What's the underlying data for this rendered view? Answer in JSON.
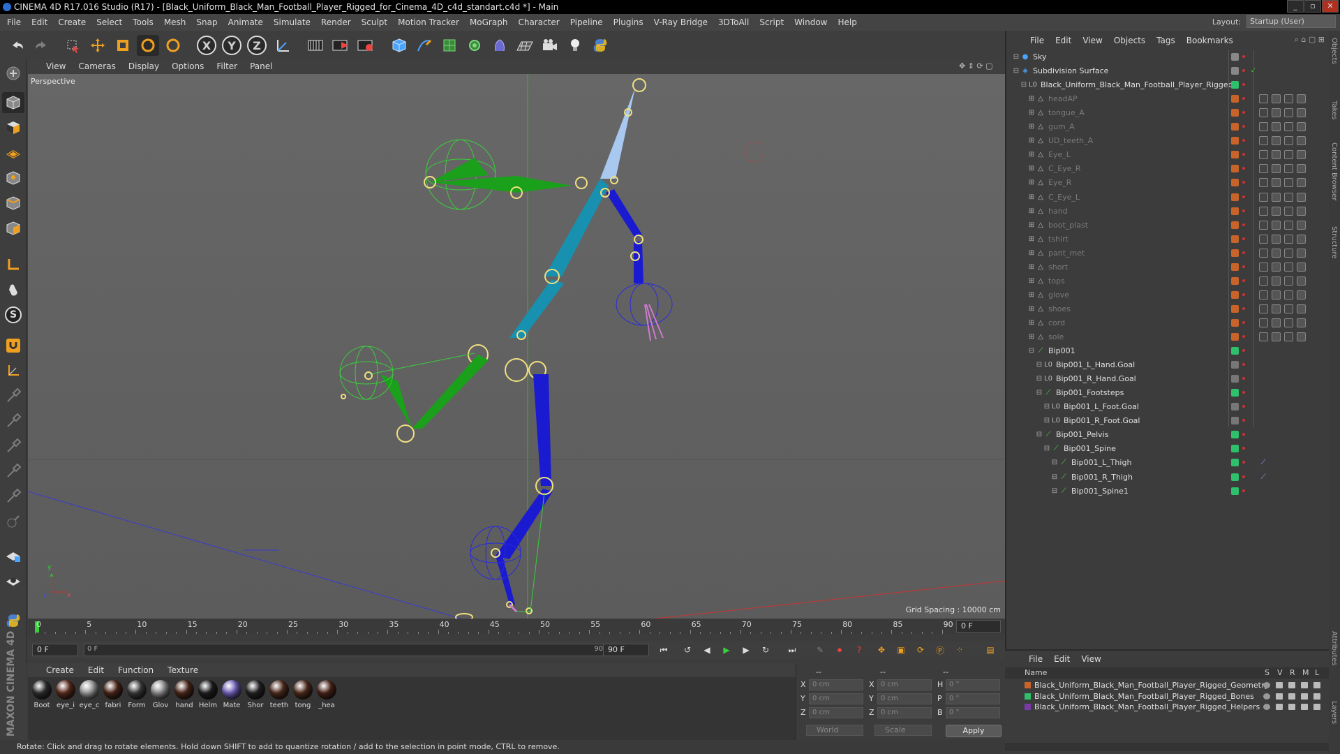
{
  "window": {
    "title": "CINEMA 4D R17.016 Studio (R17) - [Black_Uniform_Black_Man_Football_Player_Rigged_for_Cinema_4D_c4d_standart.c4d *] - Main",
    "controls": [
      "_",
      "▫",
      "✕"
    ]
  },
  "menubar": {
    "items": [
      "File",
      "Edit",
      "Create",
      "Select",
      "Tools",
      "Mesh",
      "Snap",
      "Animate",
      "Simulate",
      "Render",
      "Sculpt",
      "Motion Tracker",
      "MoGraph",
      "Character",
      "Pipeline",
      "Plugins",
      "V-Ray Bridge",
      "3DToAll",
      "Script",
      "Window",
      "Help"
    ],
    "layout_label": "Layout:",
    "layout_value": "Startup (User)"
  },
  "toolbar": {
    "axis_x": "X",
    "axis_y": "Y",
    "axis_z": "Z"
  },
  "lefttoolbar": {
    "snap_label": "S"
  },
  "viewport": {
    "menu": [
      "View",
      "Cameras",
      "Display",
      "Options",
      "Filter",
      "Panel"
    ],
    "label": "Perspective",
    "grid_spacing": "Grid Spacing : 10000 cm",
    "axis_labels": [
      "y",
      "x",
      "z"
    ]
  },
  "timeline": {
    "ticks": [
      "0",
      "5",
      "10",
      "15",
      "20",
      "25",
      "30",
      "35",
      "40",
      "45",
      "50",
      "55",
      "60",
      "65",
      "70",
      "75",
      "80",
      "85",
      "90"
    ],
    "current_frame": "0 F"
  },
  "playbar": {
    "start_field": "0 F",
    "slider_start": "0 F",
    "slider_end": "90 F",
    "end_field": "90 F"
  },
  "material_manager": {
    "menu": [
      "Create",
      "Edit",
      "Function",
      "Texture"
    ],
    "materials": [
      {
        "name": "Boot",
        "color": "#2e2e2e"
      },
      {
        "name": "eye_i",
        "color": "#5a2a1c"
      },
      {
        "name": "eye_c",
        "color": "#9a9a9a"
      },
      {
        "name": "fabri",
        "color": "#4a2418"
      },
      {
        "name": "Form",
        "color": "#3a3a3a"
      },
      {
        "name": "Glov",
        "color": "#8c8c8c"
      },
      {
        "name": "hand",
        "color": "#4b2619"
      },
      {
        "name": "Helm",
        "color": "#1e1e1e"
      },
      {
        "name": "Mate",
        "color": "#7060b8"
      },
      {
        "name": "Shor",
        "color": "#222222"
      },
      {
        "name": "teeth",
        "color": "#4e2a1c"
      },
      {
        "name": "tong",
        "color": "#4e2a1c"
      },
      {
        "name": "_hea",
        "color": "#4a2418"
      }
    ]
  },
  "coordinates": {
    "header_left": "--",
    "header_mid": "--",
    "header_right": "--",
    "rows": [
      {
        "a": "X",
        "av": "0 cm",
        "b": "X",
        "bv": "0 cm",
        "c": "H",
        "cv": "0 °"
      },
      {
        "a": "Y",
        "av": "0 cm",
        "b": "Y",
        "bv": "0 cm",
        "c": "P",
        "cv": "0 °"
      },
      {
        "a": "Z",
        "av": "0 cm",
        "b": "Z",
        "bv": "0 cm",
        "c": "B",
        "cv": "0 °"
      }
    ],
    "world": "World",
    "scale": "Scale",
    "apply": "Apply"
  },
  "brand": "MAXON CINEMA 4D",
  "status": "Rotate: Click and drag to rotate elements. Hold down SHIFT to add to quantize rotation / add to the selection in point mode, CTRL to remove.",
  "object_manager": {
    "menu": [
      "File",
      "Edit",
      "View",
      "Objects",
      "Tags",
      "Bookmarks"
    ],
    "objects": [
      {
        "name": "Sky",
        "indent": 0,
        "icon": "●",
        "color": "#4aa3ff",
        "dim": false
      },
      {
        "name": "Subdivision Surface",
        "indent": 0,
        "icon": "◈",
        "color": "#4aa3ff",
        "dim": false
      },
      {
        "name": "Black_Uniform_Black_Man_Football_Player_Rigged",
        "indent": 1,
        "icon": "L0",
        "color": "#bbb",
        "dim": false
      },
      {
        "name": "headAP",
        "indent": 2,
        "icon": "△",
        "color": "#bbb",
        "dim": true
      },
      {
        "name": "tongue_A",
        "indent": 2,
        "icon": "△",
        "color": "#bbb",
        "dim": true
      },
      {
        "name": "gum_A",
        "indent": 2,
        "icon": "△",
        "color": "#bbb",
        "dim": true
      },
      {
        "name": "UD_teeth_A",
        "indent": 2,
        "icon": "△",
        "color": "#bbb",
        "dim": true
      },
      {
        "name": "Eye_L",
        "indent": 2,
        "icon": "△",
        "color": "#bbb",
        "dim": true
      },
      {
        "name": "C_Eye_R",
        "indent": 2,
        "icon": "△",
        "color": "#bbb",
        "dim": true
      },
      {
        "name": "Eye_R",
        "indent": 2,
        "icon": "△",
        "color": "#bbb",
        "dim": true
      },
      {
        "name": "C_Eye_L",
        "indent": 2,
        "icon": "△",
        "color": "#bbb",
        "dim": true
      },
      {
        "name": "hand",
        "indent": 2,
        "icon": "△",
        "color": "#bbb",
        "dim": true
      },
      {
        "name": "boot_plast",
        "indent": 2,
        "icon": "△",
        "color": "#bbb",
        "dim": true
      },
      {
        "name": "tshirt",
        "indent": 2,
        "icon": "△",
        "color": "#bbb",
        "dim": true
      },
      {
        "name": "pant_met",
        "indent": 2,
        "icon": "△",
        "color": "#bbb",
        "dim": true
      },
      {
        "name": "short",
        "indent": 2,
        "icon": "△",
        "color": "#bbb",
        "dim": true
      },
      {
        "name": "tops",
        "indent": 2,
        "icon": "△",
        "color": "#bbb",
        "dim": true
      },
      {
        "name": "glove",
        "indent": 2,
        "icon": "△",
        "color": "#bbb",
        "dim": true
      },
      {
        "name": "shoes",
        "indent": 2,
        "icon": "△",
        "color": "#bbb",
        "dim": true
      },
      {
        "name": "cord",
        "indent": 2,
        "icon": "△",
        "color": "#bbb",
        "dim": true
      },
      {
        "name": "sole",
        "indent": 2,
        "icon": "△",
        "color": "#bbb",
        "dim": true
      },
      {
        "name": "Bip001",
        "indent": 2,
        "icon": "⟋",
        "color": "#5d5",
        "dim": false
      },
      {
        "name": "Bip001_L_Hand.Goal",
        "indent": 3,
        "icon": "L0",
        "color": "#bbb",
        "dim": false
      },
      {
        "name": "Bip001_R_Hand.Goal",
        "indent": 3,
        "icon": "L0",
        "color": "#bbb",
        "dim": false
      },
      {
        "name": "Bip001_Footsteps",
        "indent": 3,
        "icon": "⟋",
        "color": "#5d5",
        "dim": false
      },
      {
        "name": "Bip001_L_Foot.Goal",
        "indent": 4,
        "icon": "L0",
        "color": "#bbb",
        "dim": false
      },
      {
        "name": "Bip001_R_Foot.Goal",
        "indent": 4,
        "icon": "L0",
        "color": "#bbb",
        "dim": false
      },
      {
        "name": "Bip001_Pelvis",
        "indent": 3,
        "icon": "⟋",
        "color": "#5d5",
        "dim": false
      },
      {
        "name": "Bip001_Spine",
        "indent": 4,
        "icon": "⟋",
        "color": "#5d5",
        "dim": false
      },
      {
        "name": "Bip001_L_Thigh",
        "indent": 5,
        "icon": "⟋",
        "color": "#5d5",
        "dim": false
      },
      {
        "name": "Bip001_R_Thigh",
        "indent": 5,
        "icon": "⟋",
        "color": "#5d5",
        "dim": false
      },
      {
        "name": "Bip001_Spine1",
        "indent": 5,
        "icon": "⟋",
        "color": "#5d5",
        "dim": false
      }
    ]
  },
  "layer_manager": {
    "menu": [
      "File",
      "Edit",
      "View"
    ],
    "columns": {
      "name": "Name",
      "s": "S",
      "v": "V",
      "r": "R",
      "m": "M",
      "l": "L"
    },
    "layers": [
      {
        "name": "Black_Uniform_Black_Man_Football_Player_Rigged_Geometry",
        "color": "#c8642a"
      },
      {
        "name": "Black_Uniform_Black_Man_Football_Player_Rigged_Bones",
        "color": "#2ec06a"
      },
      {
        "name": "Black_Uniform_Black_Man_Football_Player_Rigged_Helpers",
        "color": "#7a3aa8"
      }
    ]
  },
  "side_tabs": [
    "Objects",
    "Takes",
    "Content Browser",
    "Structure",
    "Attributes",
    "Layers"
  ]
}
